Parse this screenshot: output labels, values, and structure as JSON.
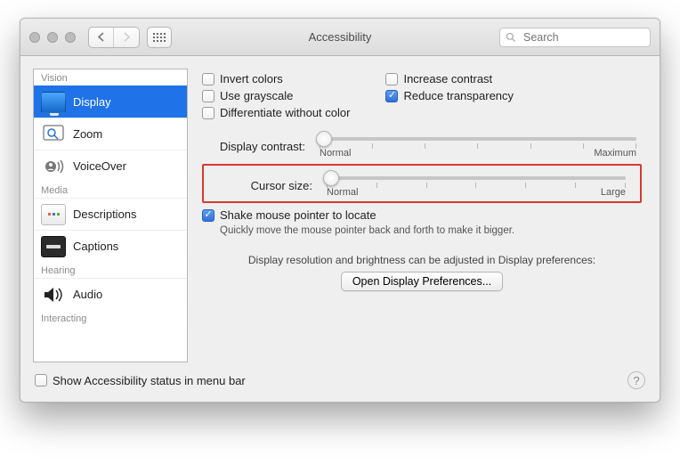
{
  "window": {
    "title": "Accessibility"
  },
  "search": {
    "placeholder": "Search",
    "value": ""
  },
  "sidebar": {
    "groups": {
      "vision": "Vision",
      "media": "Media",
      "hearing": "Hearing",
      "interacting": "Interacting"
    },
    "items": {
      "display": "Display",
      "zoom": "Zoom",
      "voiceover": "VoiceOver",
      "descriptions": "Descriptions",
      "captions": "Captions",
      "audio": "Audio"
    }
  },
  "options": {
    "invert_colors": "Invert colors",
    "use_grayscale": "Use grayscale",
    "differentiate_without_color": "Differentiate without color",
    "increase_contrast": "Increase contrast",
    "reduce_transparency": "Reduce transparency",
    "shake_pointer": "Shake mouse pointer to locate",
    "shake_desc": "Quickly move the mouse pointer back and forth to make it bigger."
  },
  "sliders": {
    "display_contrast": {
      "label": "Display contrast:",
      "min_label": "Normal",
      "max_label": "Maximum"
    },
    "cursor_size": {
      "label": "Cursor size:",
      "min_label": "Normal",
      "max_label": "Large"
    }
  },
  "note": "Display resolution and brightness can be adjusted in Display preferences:",
  "open_display_btn": "Open Display Preferences...",
  "footer_checkbox": "Show Accessibility status in menu bar"
}
